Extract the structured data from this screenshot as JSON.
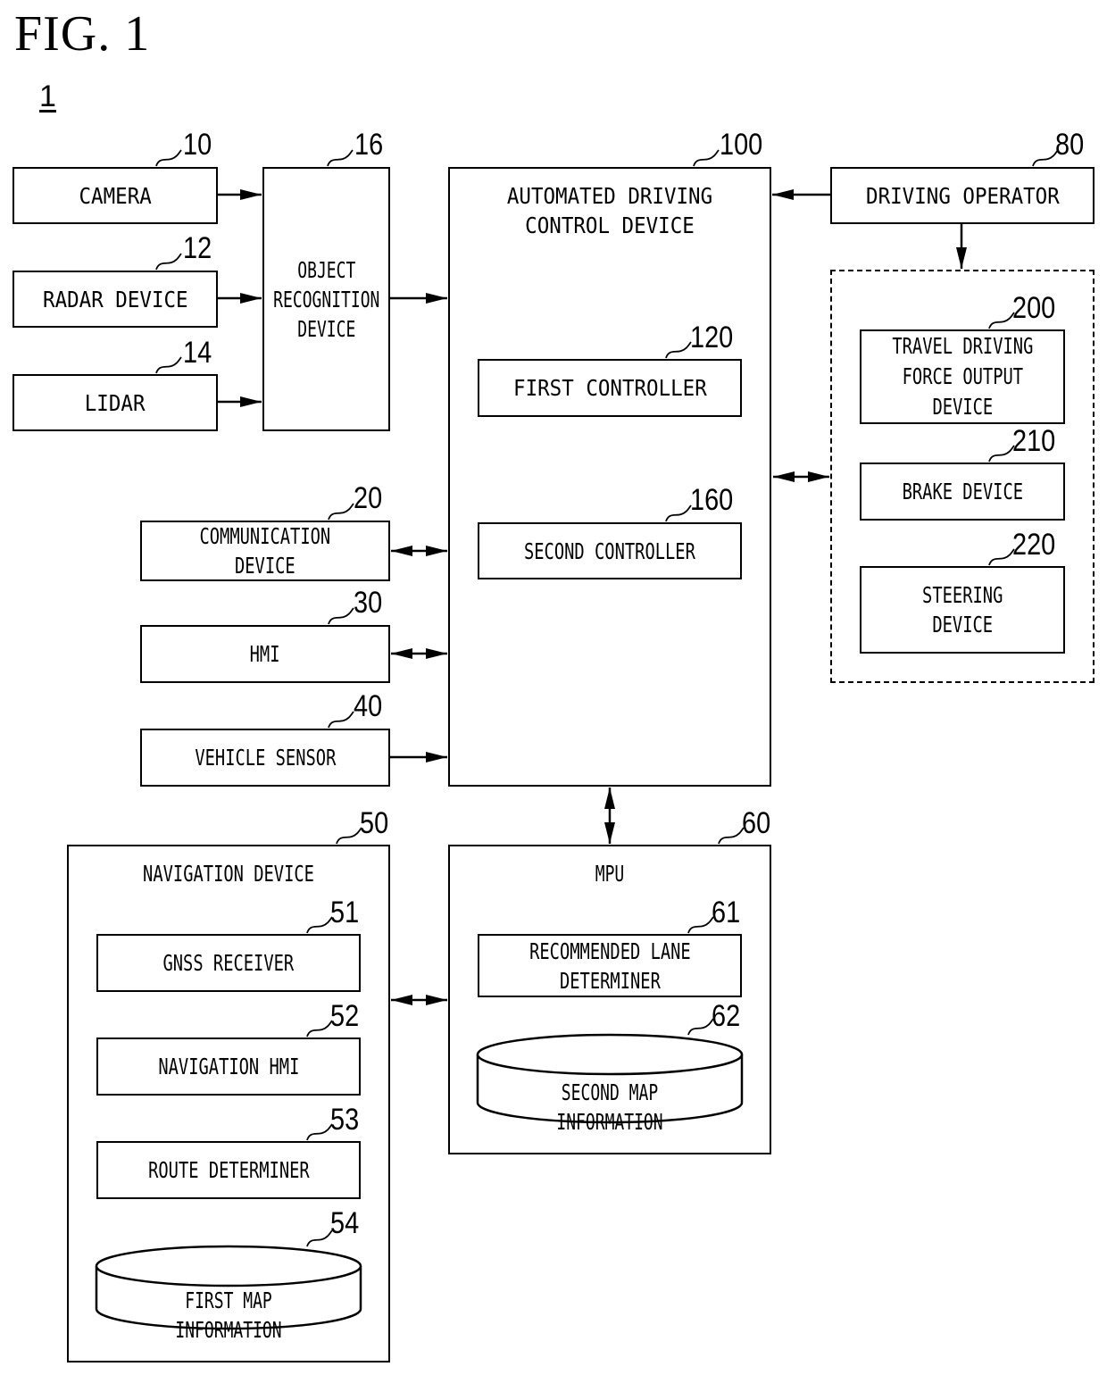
{
  "figure": {
    "title": "FIG. 1",
    "system_ref": "1"
  },
  "blocks": {
    "camera": {
      "label": "CAMERA",
      "ref": "10"
    },
    "radar": {
      "label": "RADAR DEVICE",
      "ref": "12"
    },
    "lidar": {
      "label": "LIDAR",
      "ref": "14"
    },
    "object_recognition": {
      "label": "OBJECT\nRECOGNITION\nDEVICE",
      "ref": "16"
    },
    "communication": {
      "label": "COMMUNICATION\nDEVICE",
      "ref": "20"
    },
    "hmi": {
      "label": "HMI",
      "ref": "30"
    },
    "vehicle_sensor": {
      "label": "VEHICLE SENSOR",
      "ref": "40"
    },
    "automated_driving": {
      "label": "AUTOMATED DRIVING\nCONTROL DEVICE",
      "ref": "100"
    },
    "first_controller": {
      "label": "FIRST CONTROLLER",
      "ref": "120"
    },
    "second_controller": {
      "label": "SECOND CONTROLLER",
      "ref": "160"
    },
    "driving_operator": {
      "label": "DRIVING OPERATOR",
      "ref": "80"
    },
    "travel_driving_force": {
      "label": "TRAVEL DRIVING\nFORCE OUTPUT\nDEVICE",
      "ref": "200"
    },
    "brake": {
      "label": "BRAKE DEVICE",
      "ref": "210"
    },
    "steering": {
      "label": "STEERING\nDEVICE",
      "ref": "220"
    },
    "navigation": {
      "label": "NAVIGATION DEVICE",
      "ref": "50"
    },
    "gnss": {
      "label": "GNSS RECEIVER",
      "ref": "51"
    },
    "navigation_hmi": {
      "label": "NAVIGATION HMI",
      "ref": "52"
    },
    "route_determiner": {
      "label": "ROUTE DETERMINER",
      "ref": "53"
    },
    "first_map": {
      "label": "FIRST MAP INFORMATION",
      "ref": "54"
    },
    "mpu": {
      "label": "MPU",
      "ref": "60"
    },
    "recommended_lane": {
      "label": "RECOMMENDED LANE\nDETERMINER",
      "ref": "61"
    },
    "second_map": {
      "label": "SECOND MAP INFORMATION",
      "ref": "62"
    }
  },
  "connections": [
    {
      "from": "camera",
      "to": "object_recognition",
      "direction": "one-way"
    },
    {
      "from": "radar",
      "to": "object_recognition",
      "direction": "one-way"
    },
    {
      "from": "lidar",
      "to": "object_recognition",
      "direction": "one-way"
    },
    {
      "from": "object_recognition",
      "to": "automated_driving",
      "direction": "one-way"
    },
    {
      "from": "communication",
      "to": "automated_driving",
      "direction": "two-way"
    },
    {
      "from": "hmi",
      "to": "automated_driving",
      "direction": "two-way"
    },
    {
      "from": "vehicle_sensor",
      "to": "automated_driving",
      "direction": "one-way"
    },
    {
      "from": "driving_operator",
      "to": "automated_driving",
      "direction": "one-way"
    },
    {
      "from": "driving_operator",
      "to": "output_group",
      "direction": "one-way"
    },
    {
      "from": "automated_driving",
      "to": "output_group",
      "direction": "two-way"
    },
    {
      "from": "automated_driving",
      "to": "mpu",
      "direction": "two-way"
    },
    {
      "from": "navigation",
      "to": "mpu",
      "direction": "two-way"
    }
  ]
}
